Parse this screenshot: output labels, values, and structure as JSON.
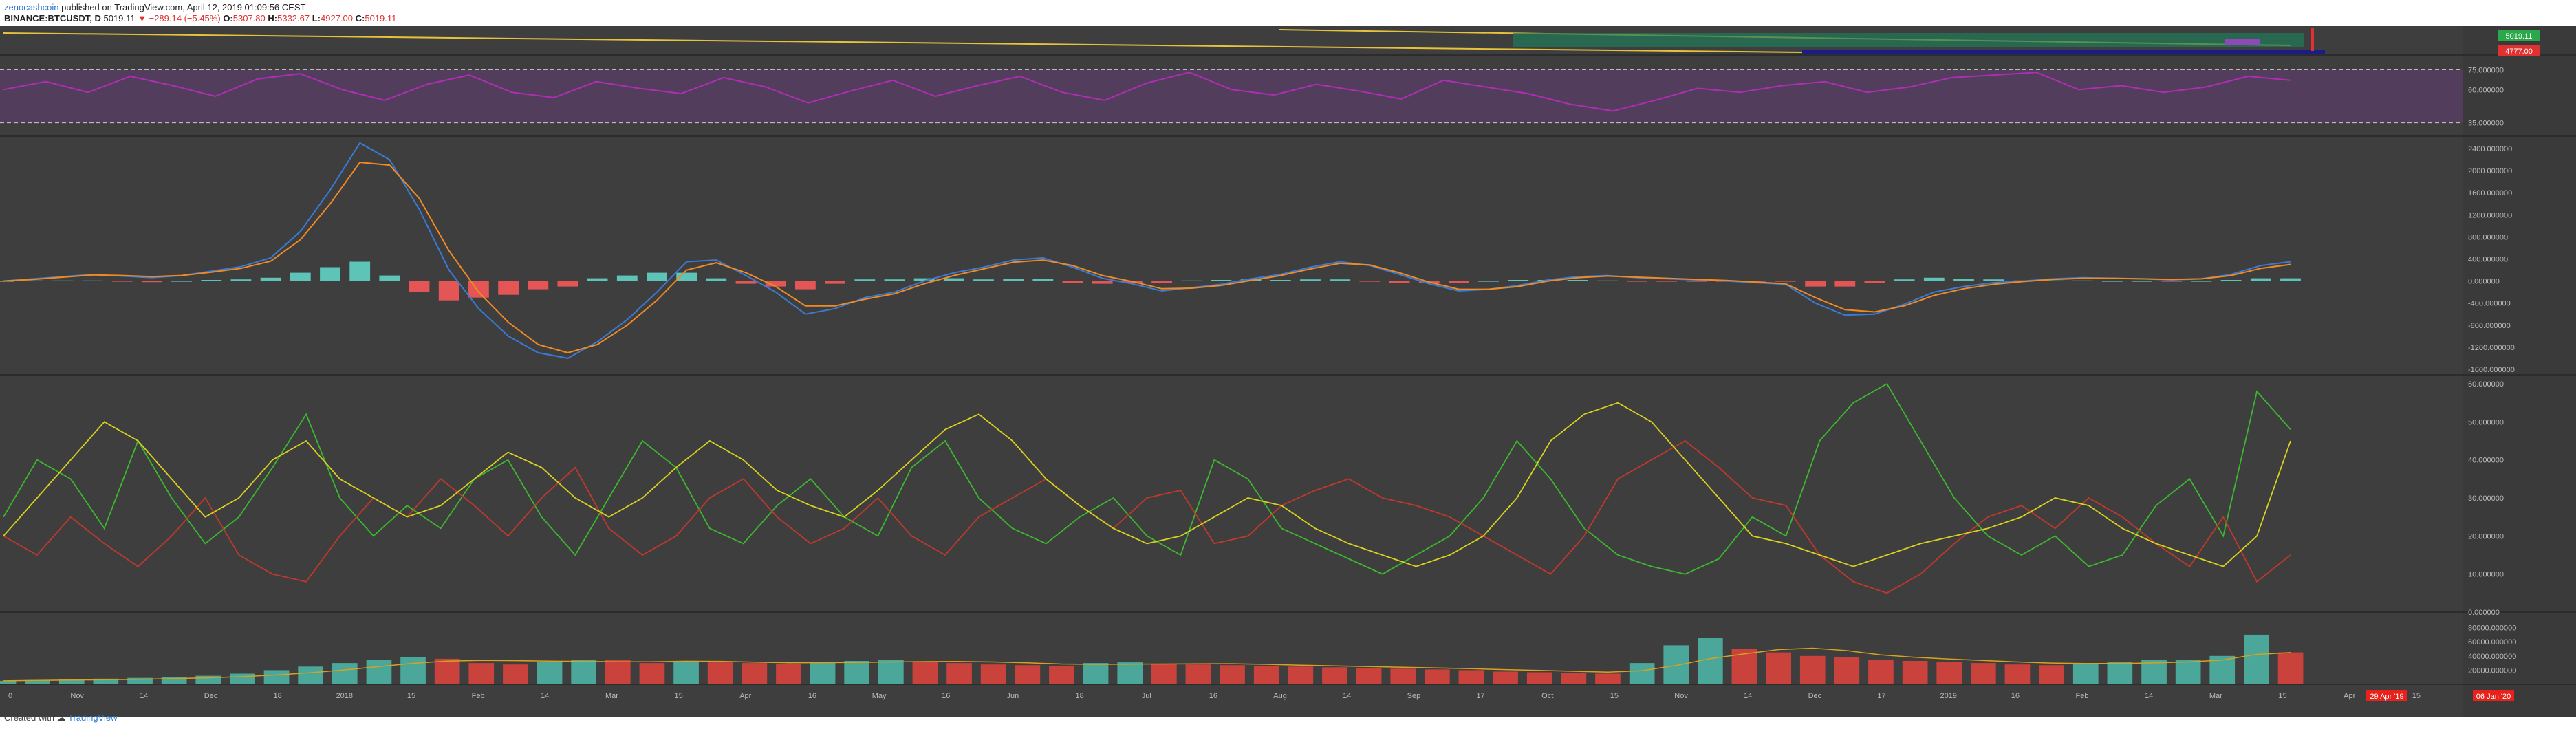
{
  "header": {
    "author": "zenocashcoin",
    "published": "published on TradingView.com, April 12, 2019 01:09:56 CEST",
    "symbol": "BINANCE:BTCUSDT, D",
    "last": "5019.11",
    "change": "▼ −289.14 (−5.45%)",
    "open_label": "O:",
    "open": "5307.80",
    "high_label": "H:",
    "high": "5332.67",
    "low_label": "L:",
    "low": "4927.00",
    "close_label": "C:",
    "close": "5019.11"
  },
  "footer": {
    "created_with": "Created with",
    "brand": "TradingView"
  },
  "price_pane": {
    "labels": [
      "5019.11",
      "4777.00"
    ],
    "label_colors": [
      "#2aa84a",
      "#e0302f"
    ]
  },
  "time_axis": {
    "ticks": [
      "0",
      "Nov",
      "14",
      "Dec",
      "18",
      "2018",
      "15",
      "Feb",
      "14",
      "Mar",
      "15",
      "Apr",
      "16",
      "May",
      "16",
      "Jun",
      "18",
      "Jul",
      "16",
      "Aug",
      "14",
      "Sep",
      "17",
      "Oct",
      "15",
      "Nov",
      "14",
      "Dec",
      "17",
      "2019",
      "16",
      "Feb",
      "14",
      "Mar",
      "15",
      "Apr",
      "15",
      "14"
    ],
    "markers": [
      "29 Apr '19",
      "06 Jan '20"
    ],
    "marker_color": "#e8221b"
  },
  "chart_data": [
    {
      "type": "line",
      "title": "",
      "description_pane": "RSI",
      "yticks": [
        "75.000000",
        "60.000000",
        "35.000000"
      ],
      "bands": [
        75,
        35
      ],
      "ylim": [
        25,
        85
      ],
      "series": [
        {
          "values": [
            60,
            66,
            58,
            70,
            63,
            55,
            68,
            72,
            60,
            52,
            64,
            71,
            58,
            54,
            66,
            61,
            57,
            69,
            62,
            50,
            59,
            67,
            55,
            63,
            70,
            58,
            52,
            65,
            73,
            60,
            56,
            64,
            59,
            53,
            67,
            62,
            57,
            49,
            44,
            52,
            61,
            58,
            63,
            66,
            58,
            62,
            69,
            71,
            73,
            60,
            63,
            58,
            62,
            70,
            67
          ]
        }
      ],
      "color": "#b02db5"
    },
    {
      "type": "bar",
      "title": "",
      "description_pane": "MACD",
      "yticks": [
        "2400.000000",
        "2000.000000",
        "1600.000000",
        "1200.000000",
        "800.000000",
        "400.000000",
        "0.000000",
        "-400.000000",
        "-800.000000",
        "-1200.000000",
        "-1600.000000"
      ],
      "ylim": [
        -1700,
        2600
      ],
      "macd": [
        0,
        40,
        80,
        120,
        90,
        60,
        100,
        180,
        260,
        420,
        900,
        1650,
        2500,
        2200,
        1300,
        200,
        -500,
        -1000,
        -1300,
        -1400,
        -1100,
        -700,
        -200,
        350,
        380,
        100,
        -200,
        -600,
        -500,
        -300,
        -200,
        0,
        150,
        250,
        380,
        420,
        250,
        50,
        -50,
        -180,
        -120,
        -60,
        40,
        120,
        250,
        350,
        280,
        120,
        -50,
        -180,
        -150,
        -80,
        20,
        80,
        100,
        60,
        40,
        20,
        0,
        -30,
        -60,
        -400,
        -620,
        -600,
        -420,
        -200,
        -100,
        -30,
        0,
        40,
        60,
        50,
        40,
        20,
        40,
        120,
        280,
        350
      ],
      "signal": [
        0,
        30,
        70,
        110,
        100,
        80,
        100,
        160,
        230,
        360,
        750,
        1400,
        2150,
        2100,
        1500,
        550,
        -200,
        -750,
        -1150,
        -1300,
        -1150,
        -800,
        -350,
        200,
        330,
        150,
        -100,
        -450,
        -450,
        -330,
        -230,
        -50,
        100,
        220,
        340,
        380,
        280,
        100,
        -10,
        -140,
        -130,
        -80,
        10,
        100,
        220,
        320,
        290,
        150,
        -20,
        -150,
        -150,
        -100,
        0,
        60,
        90,
        70,
        50,
        30,
        10,
        -20,
        -50,
        -300,
        -520,
        -560,
        -450,
        -260,
        -140,
        -60,
        -10,
        30,
        50,
        50,
        40,
        30,
        40,
        100,
        230,
        300
      ],
      "colors": {
        "macd": "#3a7bd5",
        "signal": "#f08a24",
        "hist_pos": "#5ec4b8",
        "hist_neg": "#e45656"
      }
    },
    {
      "type": "line",
      "title": "",
      "description_pane": "DMI / ADX",
      "yticks": [
        "60.000000",
        "50.000000",
        "40.000000",
        "30.000000",
        "20.000000",
        "10.000000",
        "0.000000"
      ],
      "ylim": [
        0,
        62
      ],
      "series": [
        {
          "values": [
            25,
            40,
            35,
            22,
            45,
            30,
            18,
            25,
            38,
            52,
            30,
            20,
            28,
            22,
            35,
            40,
            25,
            15,
            30,
            45,
            38,
            22,
            18,
            28,
            35,
            25,
            20,
            38,
            45,
            30,
            22,
            18,
            25,
            30,
            20,
            15,
            40,
            35,
            22,
            18,
            14,
            10,
            15,
            20,
            30,
            45,
            35,
            22,
            15,
            12,
            10,
            14,
            25,
            20,
            45,
            55,
            60,
            45,
            30,
            20,
            15,
            20,
            12,
            15,
            28,
            35,
            20,
            58,
            48
          ]
        },
        {
          "values": [
            20,
            15,
            25,
            18,
            12,
            20,
            30,
            15,
            10,
            8,
            20,
            30,
            25,
            35,
            28,
            20,
            30,
            38,
            22,
            15,
            20,
            30,
            35,
            25,
            18,
            22,
            30,
            20,
            15,
            25,
            30,
            35,
            28,
            22,
            30,
            32,
            18,
            20,
            28,
            32,
            35,
            30,
            28,
            25,
            20,
            15,
            10,
            20,
            35,
            40,
            45,
            38,
            30,
            28,
            15,
            8,
            5,
            10,
            18,
            25,
            28,
            22,
            30,
            25,
            18,
            12,
            25,
            8,
            15
          ]
        },
        {
          "values": [
            20,
            30,
            40,
            50,
            45,
            35,
            25,
            30,
            40,
            45,
            35,
            30,
            25,
            28,
            35,
            42,
            38,
            30,
            25,
            30,
            38,
            45,
            40,
            32,
            28,
            25,
            32,
            40,
            48,
            52,
            45,
            35,
            28,
            22,
            18,
            20,
            25,
            30,
            28,
            22,
            18,
            15,
            12,
            15,
            20,
            30,
            45,
            52,
            55,
            50,
            40,
            30,
            20,
            18,
            15,
            12,
            15,
            18,
            20,
            22,
            25,
            30,
            28,
            22,
            18,
            15,
            12,
            20,
            45
          ]
        }
      ],
      "colors": [
        "#3cb82f",
        "#c0392b",
        "#d7d21f"
      ]
    },
    {
      "type": "bar",
      "title": "",
      "description_pane": "Volume",
      "yticks": [
        "80000.000000",
        "60000.000000",
        "40000.000000",
        "20000.000000"
      ],
      "ylim": [
        0,
        100000
      ],
      "values": [
        5000,
        6000,
        7000,
        8000,
        9000,
        10000,
        12000,
        15000,
        20000,
        25000,
        30000,
        35000,
        38000,
        36000,
        30000,
        28000,
        32000,
        35000,
        34000,
        30000,
        32000,
        31000,
        30000,
        29000,
        31000,
        33000,
        35000,
        32000,
        30000,
        28000,
        27000,
        26000,
        30000,
        31000,
        29000,
        28000,
        27000,
        26000,
        25000,
        24000,
        23000,
        22000,
        21000,
        20000,
        18000,
        17000,
        16000,
        15000,
        30000,
        55000,
        65000,
        50000,
        45000,
        40000,
        38000,
        35000,
        33000,
        32000,
        30000,
        28000,
        27000,
        30000,
        32000,
        34000,
        35000,
        40000,
        70000,
        45000
      ],
      "colors": {
        "up": "#4aa79a",
        "down": "#c9423c",
        "ma": "#d7a21f"
      }
    }
  ]
}
